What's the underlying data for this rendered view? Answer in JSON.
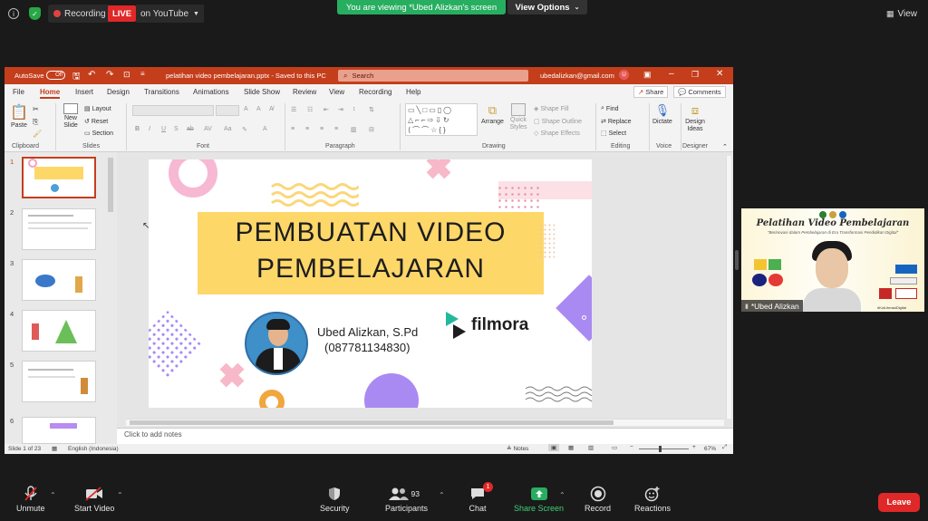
{
  "zoom": {
    "recording_label": "Recording",
    "live_label": "LIVE",
    "youtube_label": "on YouTube",
    "share_banner": "You are viewing *Ubed Alizkan's screen",
    "view_options": "View Options",
    "view_label": "View",
    "participants_count": "93",
    "chat_badge": "1",
    "toolbar": {
      "unmute": "Unmute",
      "start_video": "Start Video",
      "security": "Security",
      "participants": "Participants",
      "chat": "Chat",
      "share_screen": "Share Screen",
      "record": "Record",
      "reactions": "Reactions",
      "leave": "Leave"
    }
  },
  "ppt": {
    "autosave": "AutoSave",
    "autosave_state": "Off",
    "file_title": "pelatihan video pembelajaran.pptx  -  Saved to this PC",
    "search_placeholder": "Search",
    "account": "ubedalizkan@gmail.com",
    "avatar_initial": "U",
    "tabs": [
      "File",
      "Home",
      "Insert",
      "Design",
      "Transitions",
      "Animations",
      "Slide Show",
      "Review",
      "View",
      "Recording",
      "Help"
    ],
    "share": "Share",
    "comments": "Comments",
    "ribbon": {
      "paste": "Paste",
      "new_slide": "New Slide",
      "layout": "Layout",
      "reset": "Reset",
      "section": "Section",
      "arrange": "Arrange",
      "quick_styles": "Quick Styles",
      "shape_fill": "Shape Fill",
      "shape_outline": "Shape Outline",
      "shape_effects": "Shape Effects",
      "find": "Find",
      "replace": "Replace",
      "select": "Select",
      "dictate": "Dictate",
      "design_ideas": "Design Ideas",
      "groups": {
        "clipboard": "Clipboard",
        "slides": "Slides",
        "font": "Font",
        "paragraph": "Paragraph",
        "drawing": "Drawing",
        "editing": "Editing",
        "voice": "Voice",
        "designer": "Designer"
      }
    },
    "thumb_numbers": [
      "1",
      "2",
      "3",
      "4",
      "5",
      "6"
    ],
    "notes_placeholder": "Click to add notes",
    "status": {
      "slide_of": "Slide 1 of 23",
      "language": "English (Indonesia)",
      "notes": "Notes",
      "zoom": "67%"
    }
  },
  "slide": {
    "title_line1": "PEMBUATAN VIDEO",
    "title_line2": "PEMBELAJARAN",
    "presenter_name": "Ubed Alizkan, S.Pd",
    "presenter_phone": "(087781134830)",
    "brand": "filmora"
  },
  "tile": {
    "title": "Pelatihan Video Pembelajaran",
    "subtitle": "\"Berinovasi dalam Pembelajaran di Era Transformasi Pendidikan Digital\"",
    "name": "*Ubed Alizkan",
    "hashtag": "#KolLiterasiDigital"
  },
  "colors": {
    "ppt_accent": "#c43e1c",
    "share_green": "#27ae60",
    "live_red": "#e02828",
    "slide_yellow": "#fed769"
  }
}
